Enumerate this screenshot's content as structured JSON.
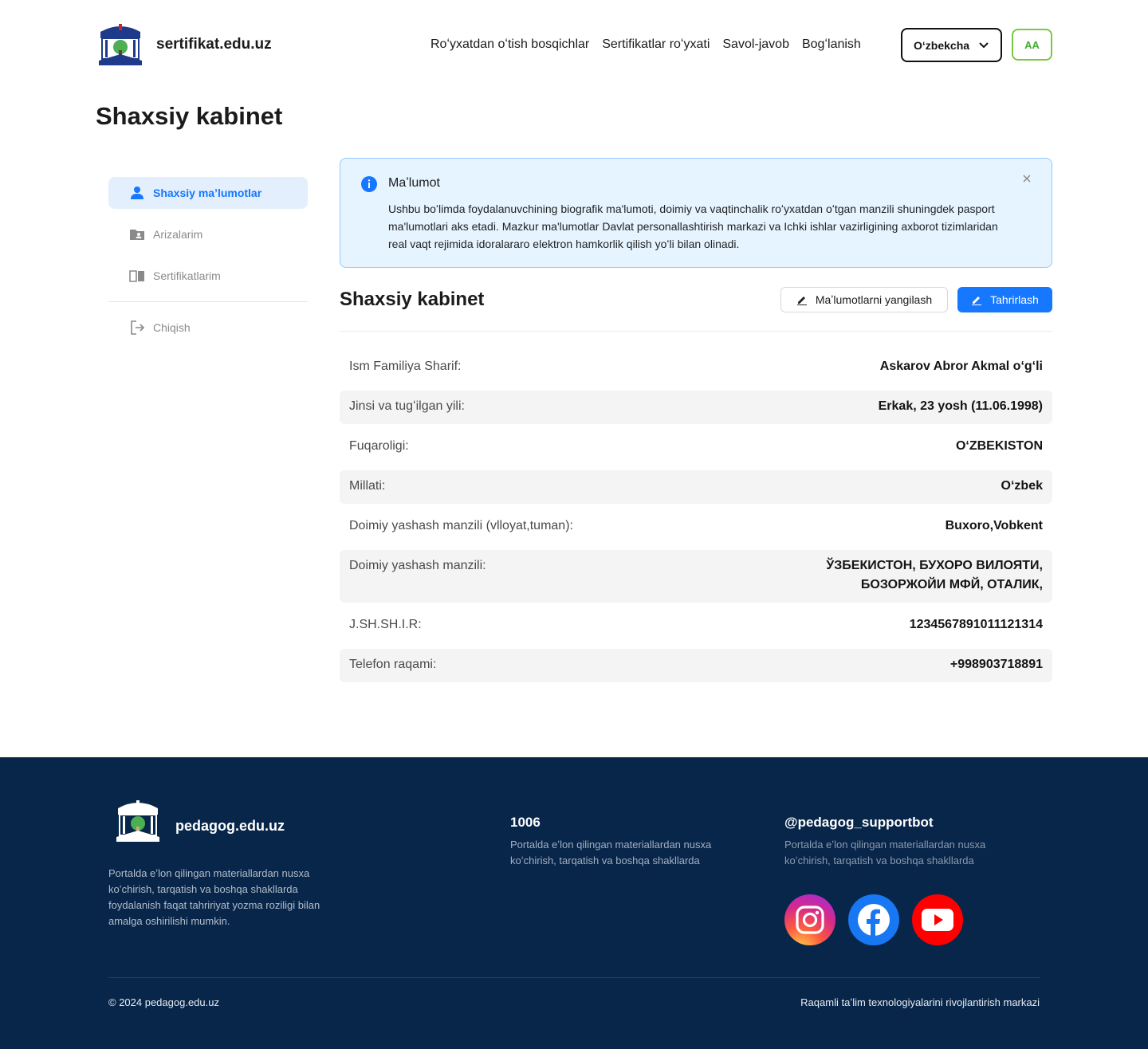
{
  "header": {
    "brand": "sertifikat.edu.uz",
    "nav": [
      "Roʻyxatdan oʻtish bosqichlar",
      "Sertifikatlar roʻyxati",
      "Savol-javob",
      "Bogʻlanish"
    ],
    "language": "Oʻzbekcha",
    "accessibility": "AA"
  },
  "page_title": "Shaxsiy kabinet",
  "sidebar": {
    "items": [
      {
        "label": "Shaxsiy maʼlumotlar",
        "icon": "user-icon",
        "active": true
      },
      {
        "label": "Arizalarim",
        "icon": "folder-user-icon"
      },
      {
        "label": "Sertifikatlarim",
        "icon": "book-open-icon"
      },
      {
        "label": "Chiqish",
        "icon": "logout-icon"
      }
    ]
  },
  "info": {
    "title": "Maʼlumot",
    "text": "Ushbu boʻlimda foydalanuvchining biografik ma'lumoti, doimiy va vaqtinchalik roʻyxatdan oʻtgan manzili shuningdek pasport ma'lumotlari aks etadi. Mazkur ma'lumotlar Davlat personallashtirish markazi va Ichki ishlar vazirligining axborot tizimlaridan real vaqt rejimida idoralararo elektron hamkorlik qilish yoʻli bilan olinadi."
  },
  "section": {
    "title": "Shaxsiy kabinet",
    "update_button": "Maʼlumotlarni yangilash",
    "edit_button": "Tahrirlash"
  },
  "rows": [
    {
      "label": "Ism Familiya Sharif:",
      "value": "Askarov Abror Akmal oʻgʻli"
    },
    {
      "label": "Jinsi va tugʻilgan yili:",
      "value": "Erkak, 23 yosh (11.06.1998)"
    },
    {
      "label": "Fuqaroligi:",
      "value": "OʻZBEKISTON"
    },
    {
      "label": "Millati:",
      "value": "Oʻzbek"
    },
    {
      "label": "Doimiy yashash manzili (vlloyat,tuman):",
      "value": "Buxoro,Vobkent"
    },
    {
      "label": "Doimiy yashash manzili:",
      "value": "ЎЗБЕКИСТОН, БУХОРО ВИЛОЯТИ,\nБОЗОРЖОЙИ МФЙ, ОТАЛИК,"
    },
    {
      "label": "J.SH.SH.I.R:",
      "value": "1234567891011121314"
    },
    {
      "label": "Telefon raqami:",
      "value": "+998903718891"
    }
  ],
  "footer": {
    "brand": "pedagog.edu.uz",
    "description": "Portalda eʼlon qilingan materiallardan nusxa koʻchirish, tarqatish va boshqa shakllarda foydalanish faqat tahririyat yozma roziligi bilan amalga oshirilishi mumkin.",
    "phone_title": "1006",
    "phone_desc": "Portalda eʼlon qilingan materiallardan nusxa koʻchirish, tarqatish va boshqa shakllarda",
    "bot_title": "@pedagog_supportbot",
    "bot_desc": "Portalda eʼlon qilingan materiallardan nusxa koʻchirish, tarqatish va boshqa shakllarda",
    "socials": [
      "instagram-icon",
      "facebook-icon",
      "youtube-icon"
    ],
    "copyright": "© 2024 pedagog.edu.uz",
    "org": "Raqamli taʼlim texnologiyalarini rivojlantirish markazi"
  },
  "colors": {
    "primary": "#1677ff",
    "info_bg": "#e6f4ff",
    "footer_bg": "#08264a",
    "accent_green": "#7ac943"
  }
}
